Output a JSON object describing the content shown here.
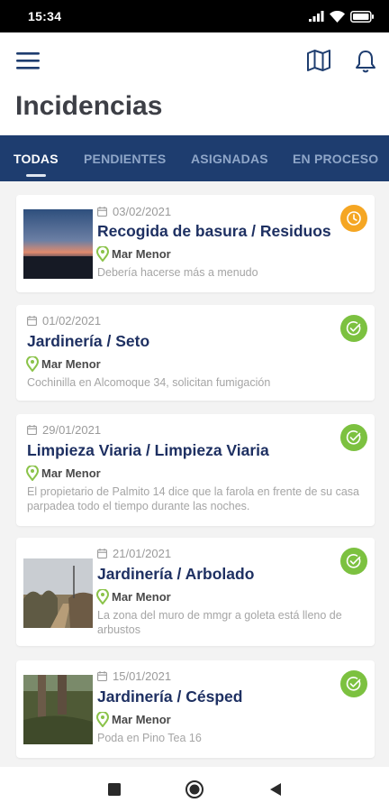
{
  "status_bar": {
    "time": "15:34"
  },
  "header": {
    "title": "Incidencias"
  },
  "icons": {
    "menu": "hamburger-menu-icon",
    "map": "map-icon",
    "notifications": "bell-icon",
    "calendar": "calendar-icon",
    "location": "location-pin-icon",
    "pending": "clock-icon",
    "done": "check-circle-icon"
  },
  "colors": {
    "tab_bar": "#1e3d6f",
    "title_text": "#1e3062",
    "status_pending": "#f5a623",
    "status_done": "#7cc140",
    "location_pin": "#8bc34a"
  },
  "tabs": [
    {
      "label": "TODAS",
      "active": true
    },
    {
      "label": "PENDIENTES",
      "active": false
    },
    {
      "label": "ASIGNADAS",
      "active": false
    },
    {
      "label": "EN PROCESO",
      "active": false
    }
  ],
  "incidents": [
    {
      "date": "03/02/2021",
      "title": "Recogida de basura / Residuos",
      "location": "Mar Menor",
      "description": "Debería hacerse más a menudo",
      "status": "pending",
      "has_photo": true
    },
    {
      "date": "01/02/2021",
      "title": "Jardinería / Seto",
      "location": "Mar Menor",
      "description": "Cochinilla en Alcomoque 34, solicitan fumigación",
      "status": "done",
      "has_photo": false
    },
    {
      "date": "29/01/2021",
      "title": "Limpieza Viaria / Limpieza Viaria",
      "location": "Mar Menor",
      "description": "El propietario de Palmito 14 dice que la farola en frente de su casa parpadea todo el tiempo durante las noches.",
      "status": "done",
      "has_photo": false
    },
    {
      "date": "21/01/2021",
      "title": "Jardinería / Arbolado",
      "location": "Mar Menor",
      "description": "La zona del muro de mmgr a goleta está lleno de arbustos",
      "status": "done",
      "has_photo": true
    },
    {
      "date": "15/01/2021",
      "title": "Jardinería / Césped",
      "location": "Mar Menor",
      "description": "Poda en Pino Tea 16",
      "status": "done",
      "has_photo": true
    }
  ],
  "nav_bar": {
    "recents": "square-icon",
    "home": "circle-icon",
    "back": "triangle-back-icon"
  }
}
